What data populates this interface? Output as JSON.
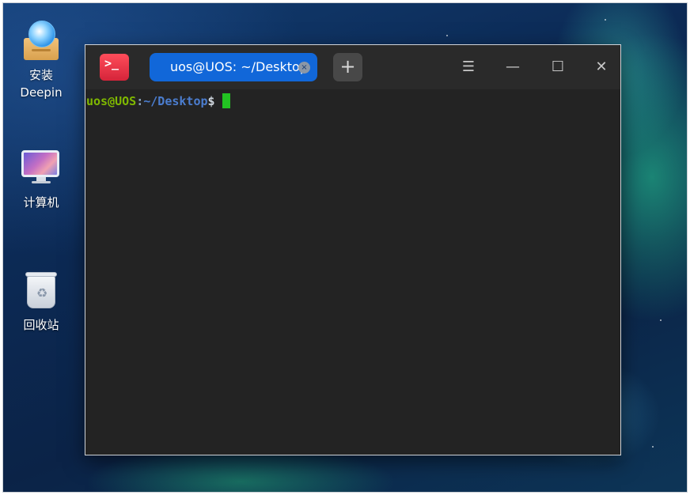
{
  "desktop": {
    "icons": [
      {
        "label_line1": "安装",
        "label_line2": "Deepin",
        "icon": "install-package-icon"
      },
      {
        "label": "计算机",
        "icon": "computer-icon"
      },
      {
        "label": "回收站",
        "icon": "trash-icon"
      }
    ]
  },
  "terminal": {
    "app_icon_glyph": ">_",
    "tab": {
      "title": "uos@UOS: ~/Desktop",
      "close_glyph": "×"
    },
    "new_tab_glyph": "+",
    "window_controls": {
      "menu": "☰",
      "minimize": "—",
      "maximize": "☐",
      "close": "✕"
    },
    "prompt": {
      "user_host": "uos@UOS",
      "colon": ":",
      "path": "~/Desktop",
      "symbol": "$"
    }
  },
  "colors": {
    "tab_active": "#1167d9",
    "prompt_user": "#7fb800",
    "prompt_path": "#4b7dcf",
    "cursor": "#22c322",
    "terminal_bg": "#232323"
  }
}
